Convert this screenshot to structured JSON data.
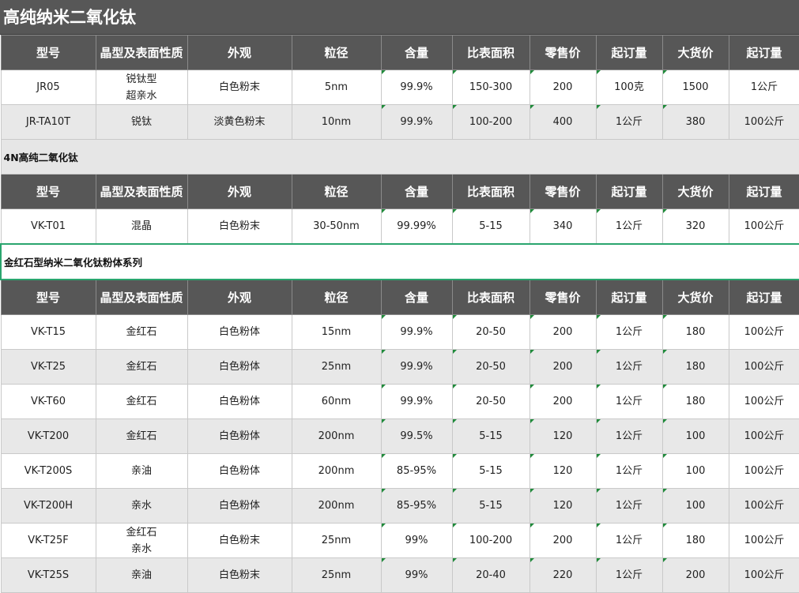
{
  "title": "高纯纳米二氧化钛",
  "headers": [
    "型号",
    "晶型及表面性质",
    "外观",
    "粒径",
    "含量",
    "比表面积",
    "零售价",
    "起订量",
    "大货价",
    "起订量"
  ],
  "group1": {
    "rows": [
      [
        "JR05",
        "锐钛型\n超亲水",
        "白色粉末",
        "5nm",
        "99.9%",
        "150-300",
        "200",
        "100克",
        "1500",
        "1公斤"
      ],
      [
        "JR-TA10T",
        "锐钛",
        "淡黄色粉末",
        "10nm",
        "99.9%",
        "100-200",
        "400",
        "1公斤",
        "380",
        "100公斤"
      ]
    ]
  },
  "group2": {
    "section": "4N高纯二氧化钛",
    "rows": [
      [
        "VK-T01",
        "混晶",
        "白色粉末",
        "30-50nm",
        "99.99%",
        "5-15",
        "340",
        "1公斤",
        "320",
        "100公斤"
      ]
    ]
  },
  "group3": {
    "section": "金红石型纳米二氧化钛粉体系列",
    "rows": [
      [
        "VK-T15",
        "金红石",
        "白色粉体",
        "15nm",
        "99.9%",
        "20-50",
        "200",
        "1公斤",
        "180",
        "100公斤"
      ],
      [
        "VK-T25",
        "金红石",
        "白色粉体",
        "25nm",
        "99.9%",
        "20-50",
        "200",
        "1公斤",
        "180",
        "100公斤"
      ],
      [
        "VK-T60",
        "金红石",
        "白色粉体",
        "60nm",
        "99.9%",
        "20-50",
        "200",
        "1公斤",
        "180",
        "100公斤"
      ],
      [
        "VK-T200",
        "金红石",
        "白色粉体",
        "200nm",
        "99.5%",
        "5-15",
        "120",
        "1公斤",
        "100",
        "100公斤"
      ],
      [
        "VK-T200S",
        "亲油",
        "白色粉体",
        "200nm",
        "85-95%",
        "5-15",
        "120",
        "1公斤",
        "100",
        "100公斤"
      ],
      [
        "VK-T200H",
        "亲水",
        "白色粉体",
        "200nm",
        "85-95%",
        "5-15",
        "120",
        "1公斤",
        "100",
        "100公斤"
      ],
      [
        "VK-T25F",
        "金红石\n亲水",
        "白色粉末",
        "25nm",
        "99%",
        "100-200",
        "200",
        "1公斤",
        "180",
        "100公斤"
      ],
      [
        "VK-T25S",
        "亲油",
        "白色粉末",
        "25nm",
        "99%",
        "20-40",
        "220",
        "1公斤",
        "200",
        "100公斤"
      ]
    ]
  },
  "colors": {
    "header_bg": "#575757",
    "header_text": "#ffffff",
    "alt_row_bg": "#e8e8e8",
    "selection_border": "#2aa56e",
    "comment_mark": "#1f8a3a"
  }
}
